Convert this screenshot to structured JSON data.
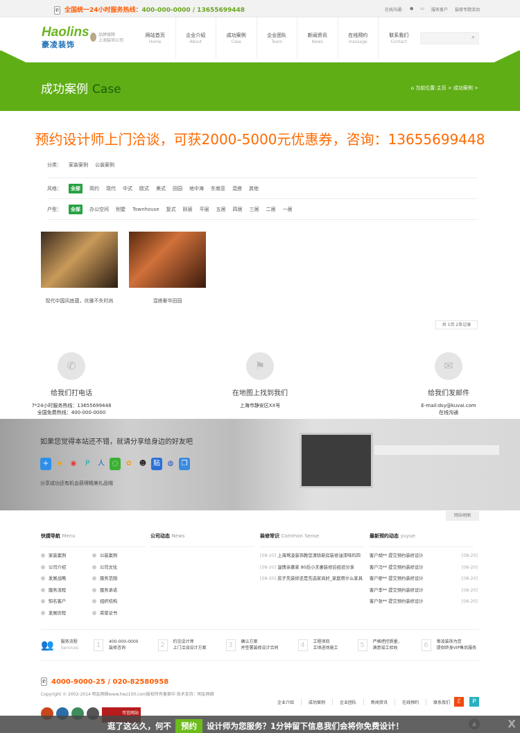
{
  "topbar": {
    "hotline_label": "全国统一24小时服务热线：",
    "hotline": "400-000-0000 / 13655699448",
    "online": "在线沟通:",
    "service": "服务客户",
    "special": "装修专题活动"
  },
  "logo": {
    "en": "Haolins",
    "cn": "豪凌装饰",
    "brand1": "品牌保障",
    "brand2": "上海装饰公司"
  },
  "nav": [
    {
      "cn": "网站首页",
      "en": "Home"
    },
    {
      "cn": "企业介绍",
      "en": "About"
    },
    {
      "cn": "成功案例",
      "en": "Case"
    },
    {
      "cn": "企业团队",
      "en": "Team"
    },
    {
      "cn": "新闻资讯",
      "en": "News"
    },
    {
      "cn": "在线预约",
      "en": "message"
    },
    {
      "cn": "联系我们",
      "en": "Contact"
    }
  ],
  "page": {
    "title": "成功案例",
    "title_en": "Case",
    "breadcrumb": "当前位置:主页 > 成功案例 >"
  },
  "promo": "预约设计师上门洽谈，可获2000-5000元优惠券，咨询：13655699448",
  "filters": {
    "category": {
      "label": "分类：",
      "items": [
        "家装案例",
        "公装案例"
      ]
    },
    "style": {
      "label": "风格：",
      "items": [
        "全部",
        "简约",
        "现代",
        "中式",
        "欧式",
        "美式",
        "田园",
        "地中海",
        "东南亚",
        "混搭",
        "其他"
      ]
    },
    "type": {
      "label": "户型：",
      "items": [
        "全部",
        "办公空间",
        "别墅",
        "Townhouse",
        "复式",
        "跃层",
        "平层",
        "五居",
        "四居",
        "三居",
        "二居",
        "一居"
      ]
    }
  },
  "cases": [
    {
      "caption": "现代中国风底蕴，优雅不失时尚"
    },
    {
      "caption": "混搭奢华田园"
    }
  ],
  "pager": "共 1页 2条记录",
  "contacts": [
    {
      "title": "给我们打电话",
      "l1": "7*24小时服务热线：13655699448",
      "l2": "全国免费热线：400-000-0000"
    },
    {
      "title": "在地图上找到我们",
      "l1": "上海市静安区XX号",
      "l2": ""
    },
    {
      "title": "给我们发邮件",
      "l1": "E-mail:dsy@kuvai.com",
      "l2": "在线沟通"
    }
  ],
  "share": {
    "title": "如果您觉得本站还不错，就请分享给身边的好友吧",
    "sub": "分享成功还有机会获得精美礼品哦"
  },
  "sitemap": "网站地图",
  "footer": {
    "menu": {
      "title": "快捷导航",
      "en": "Menu",
      "items": [
        "家装案例",
        "公装案例",
        "公司介绍",
        "公司文化",
        "发展战略",
        "服务范围",
        "服务流程",
        "服务承诺",
        "知名客户",
        "组织结构",
        "发展历程",
        "荣誉证书"
      ]
    },
    "news": {
      "title": "公司动态",
      "en": "News"
    },
    "sense": {
      "title": "装修常识",
      "en": "Common Sense",
      "items": [
        {
          "date": "[08-20]",
          "text": "上海莺凌装饰教您清除新房装修油漆味的四"
        },
        {
          "date": "[08-20]",
          "text": "温情亲慕家 80后小夫妻装修后经验分享"
        },
        {
          "date": "[08-20]",
          "text": "房子先装修还是先选家具好_家庭用什么家具"
        }
      ]
    },
    "yuyue": {
      "title": "最新预约动态",
      "en": "yuyue",
      "items": [
        {
          "text": "客户胡** 提交预约装修设计",
          "date": "[08-20]"
        },
        {
          "text": "客户冯** 提交预约装修设计",
          "date": "[08-20]"
        },
        {
          "text": "客户廖** 提交预约装修设计",
          "date": "[08-20]"
        },
        {
          "text": "客户李** 提交预约装修设计",
          "date": "[08-20]"
        },
        {
          "text": "客户张** 提交预约装修设计",
          "date": "[08-20]"
        }
      ]
    }
  },
  "services": {
    "title": "服务流程",
    "en": "Services",
    "steps": [
      {
        "n": "1",
        "a": "400-000-0000",
        "b": "装修咨询"
      },
      {
        "n": "2",
        "a": "约见设计师",
        "b": "上门洽谈设计方案"
      },
      {
        "n": "3",
        "a": "确认方案",
        "b": "并签署装修设计合同"
      },
      {
        "n": "4",
        "a": "工程项目",
        "b": "立项进场施工"
      },
      {
        "n": "5",
        "a": "严格把控质量，",
        "b": "满意竣工验收"
      },
      {
        "n": "6",
        "a": "莺凌装饰为您",
        "b": "提供终身VIP售后服务"
      }
    ]
  },
  "bottom": {
    "phone": "4000-9000-25 / 020-82580958",
    "copyright": "Copyright © 2002-2014 明友网络www.hwz100.com版权所有备案中 技术支持：明友网络",
    "links": [
      "企业介绍",
      "成功案例",
      "企业团队",
      "新闻资讯",
      "在线预约",
      "联系我们"
    ],
    "badge": "可信网站"
  },
  "bar": {
    "pre": "逛了这么久，何不",
    "btn": "预约",
    "post": "设计师为您服务？1分钟留下信息我们会将你免费设计！",
    "close": "X"
  },
  "colors": {
    "green": "#5fae16",
    "orange": "#ff6a00"
  }
}
